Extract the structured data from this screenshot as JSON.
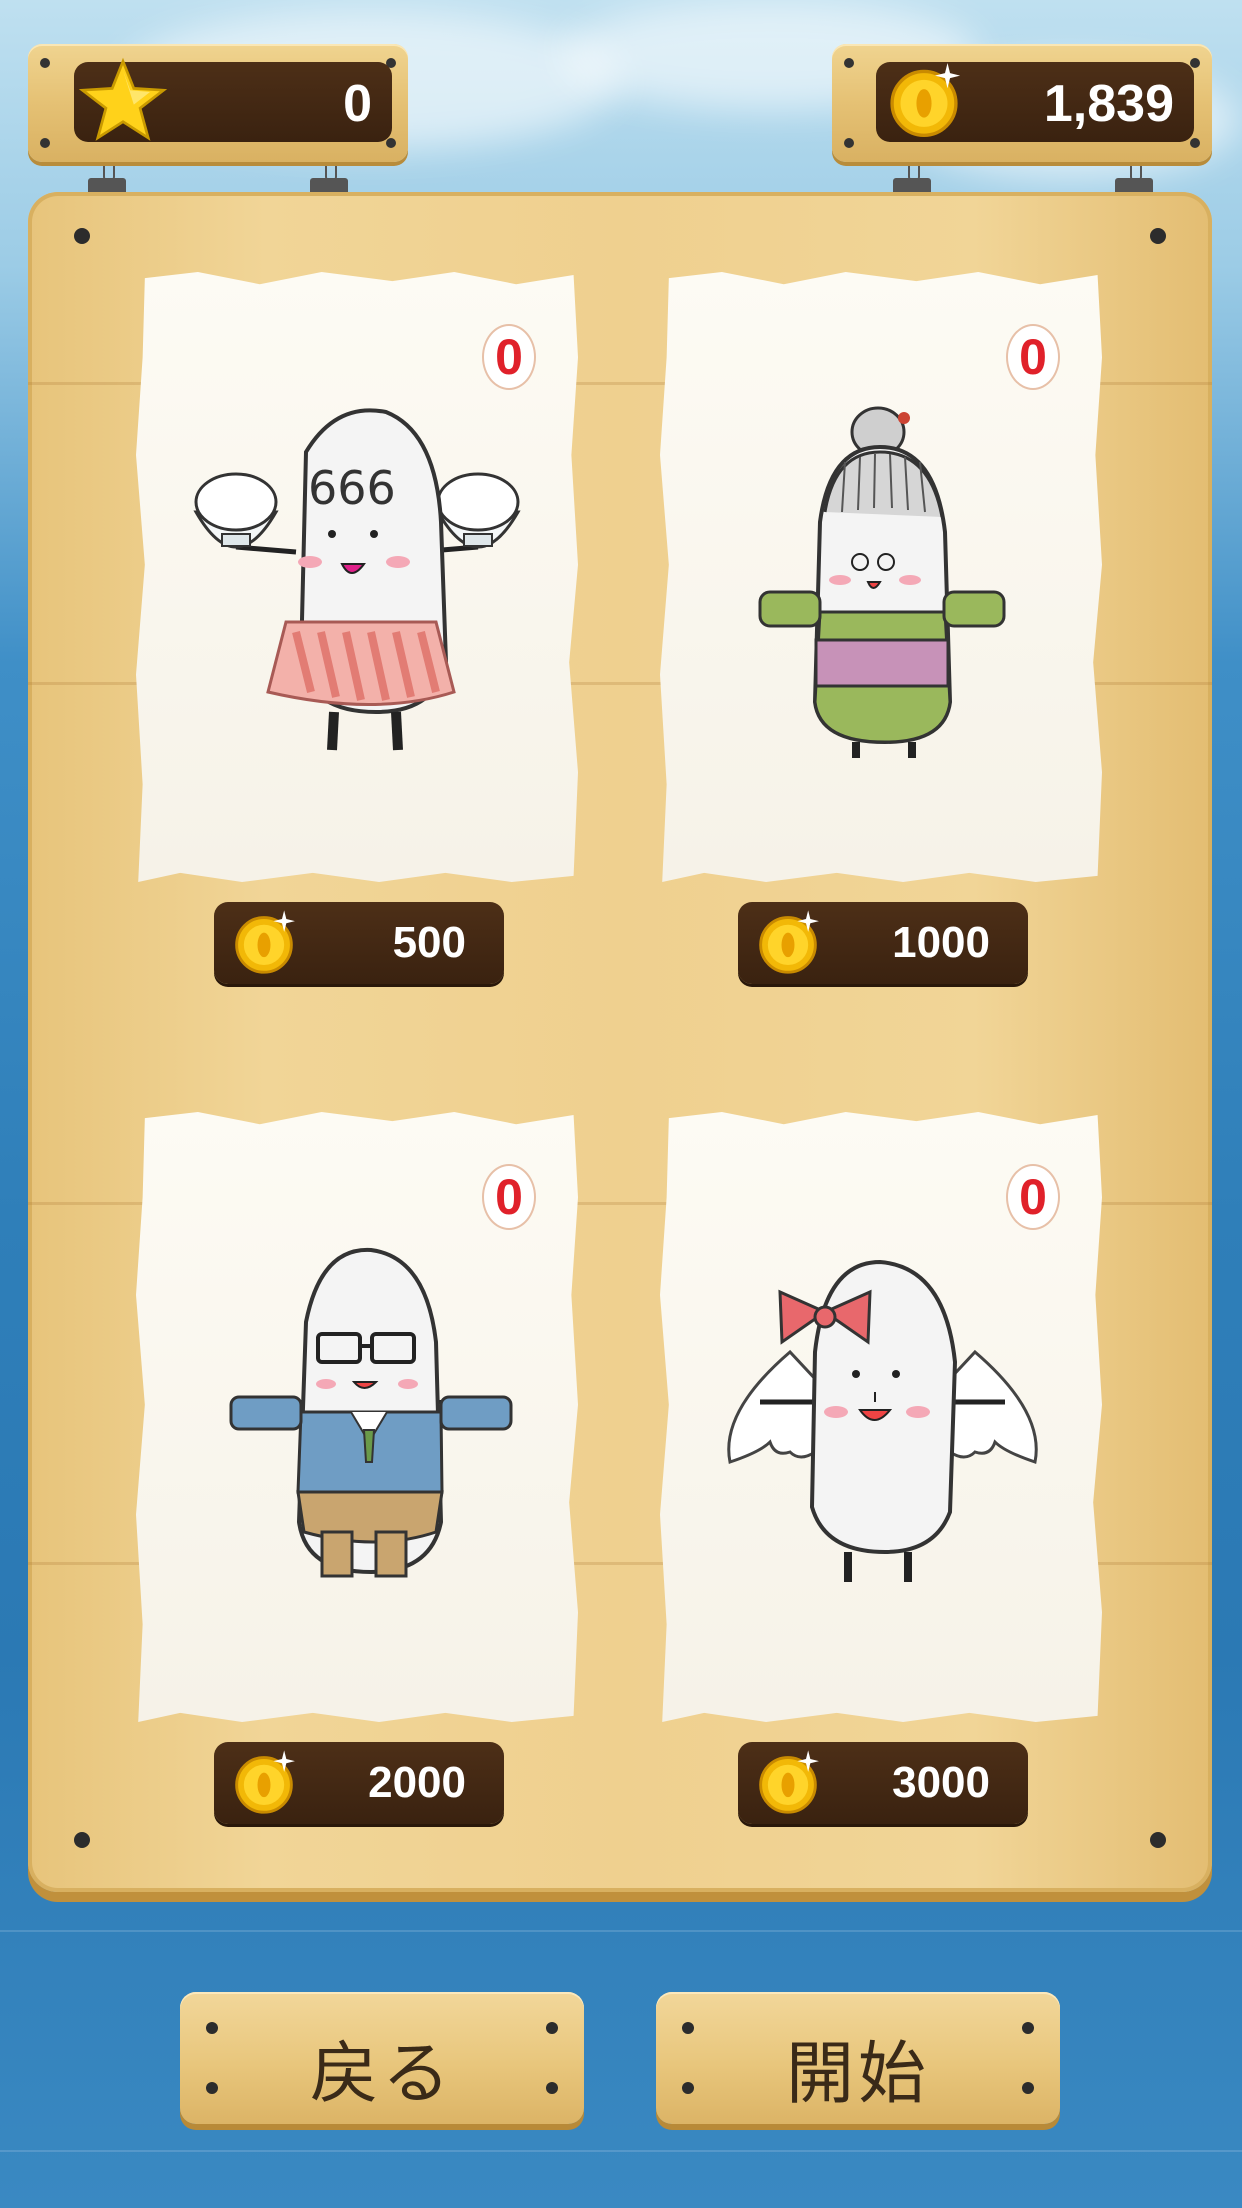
{
  "header": {
    "stars": "0",
    "coins": "1,839"
  },
  "characters": [
    {
      "owned_count": "0",
      "price": "500",
      "character_icon": "waitress-rice-character-icon"
    },
    {
      "owned_count": "0",
      "price": "1000",
      "character_icon": "grandma-rice-character-icon"
    },
    {
      "owned_count": "0",
      "price": "2000",
      "character_icon": "salaryman-rice-character-icon"
    },
    {
      "owned_count": "0",
      "price": "3000",
      "character_icon": "angel-rice-character-icon"
    }
  ],
  "buttons": {
    "back_label": "戻る",
    "start_label": "開始"
  },
  "icons": {
    "star": "star-icon",
    "coin": "coin-icon"
  },
  "colors": {
    "board": "#efd08f",
    "plate": "#3a2210",
    "badge_text": "#e0212a",
    "sea": "#2f7fb9"
  }
}
